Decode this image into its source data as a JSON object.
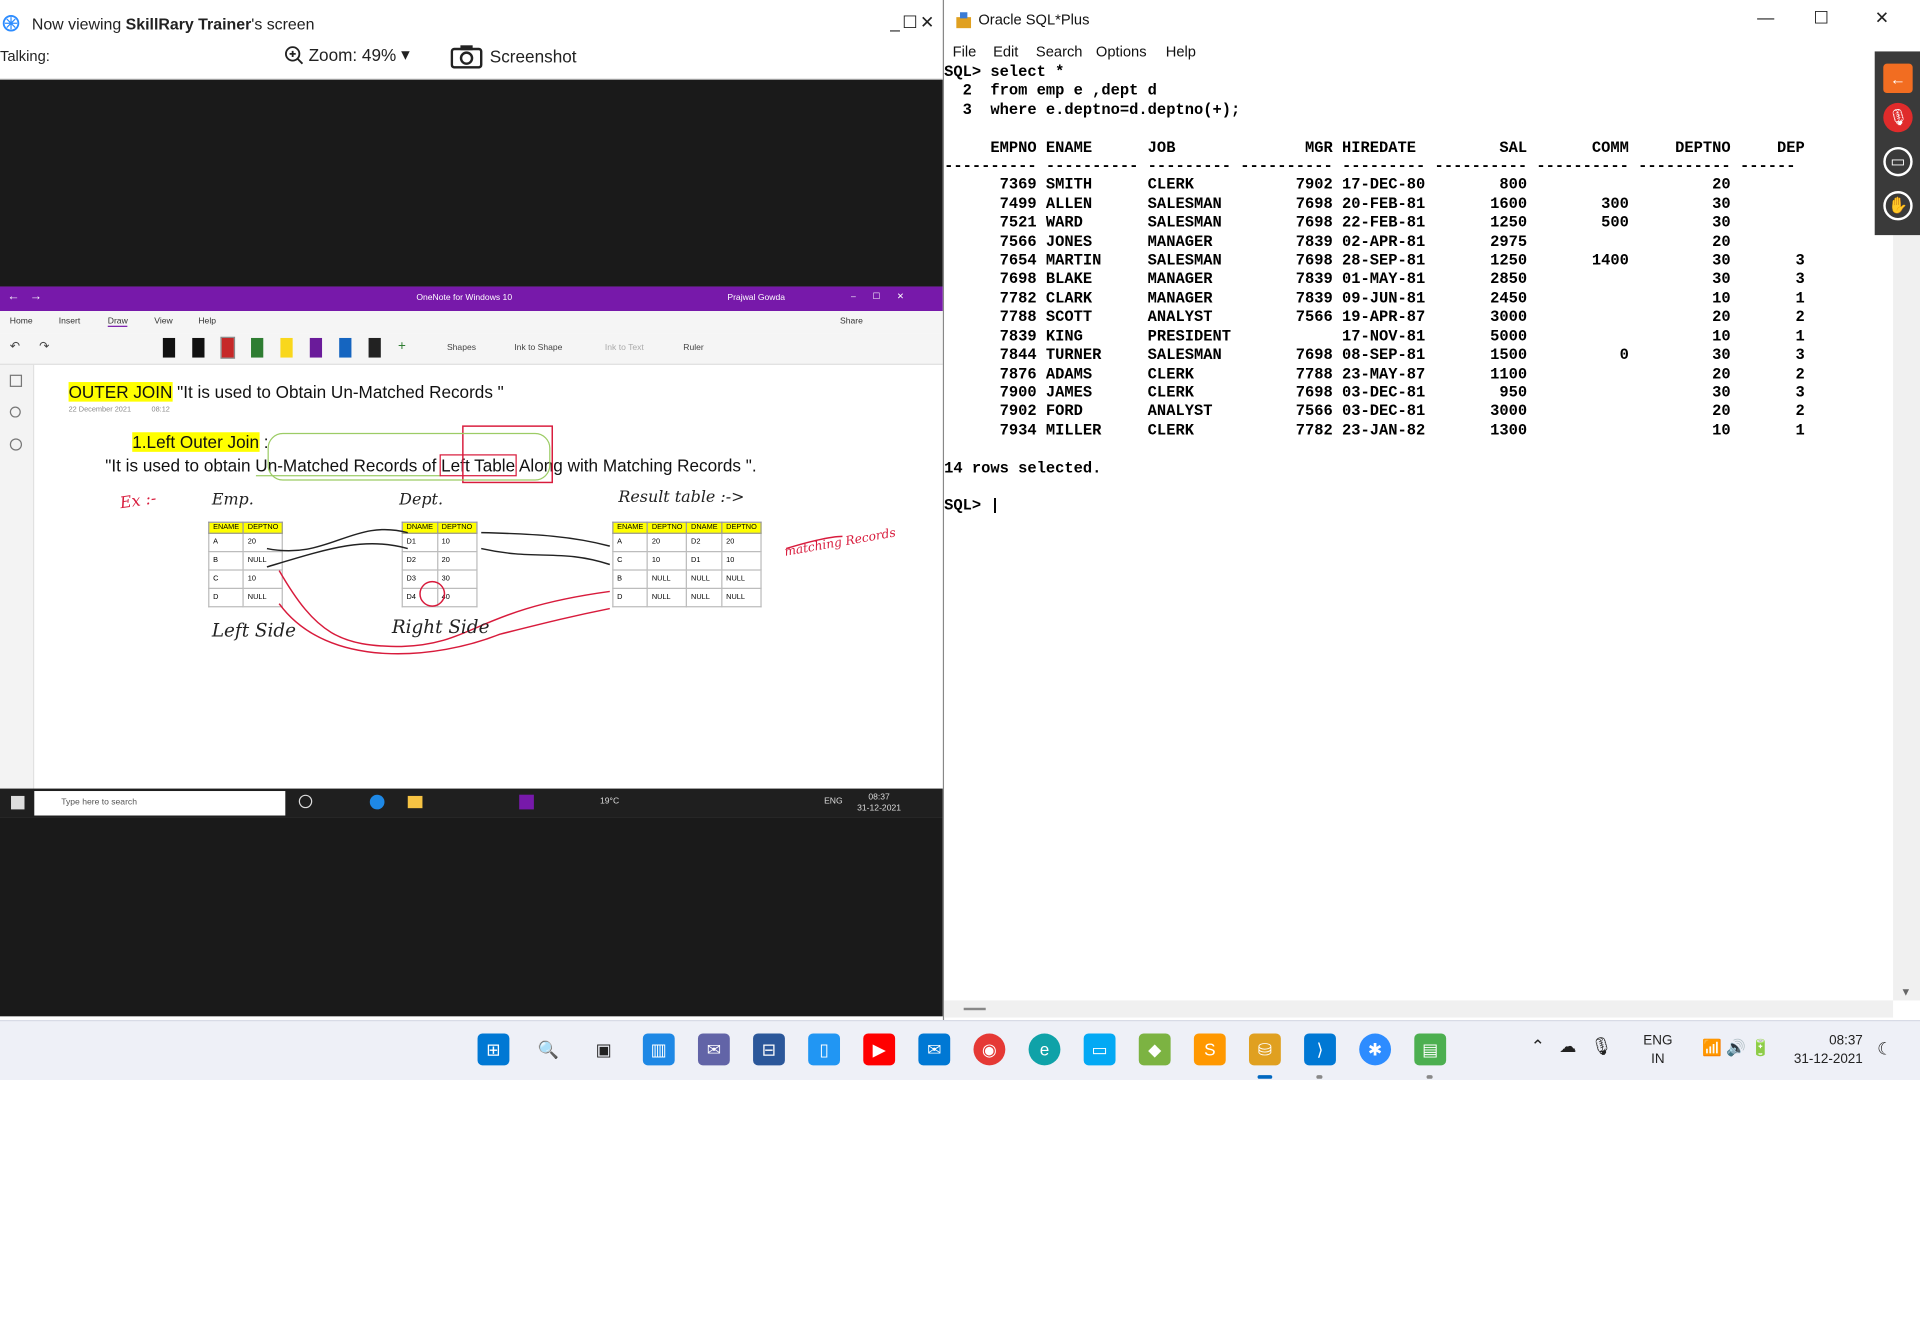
{
  "viewer": {
    "now_viewing": "Now viewing ",
    "presenter": "SkillRary Trainer",
    "screen_suffix": "'s screen",
    "talking": "Talking:",
    "zoom_label": "Zoom: 49%",
    "screenshot_label": "Screenshot",
    "window_controls": [
      "_",
      "☐",
      "✕"
    ]
  },
  "remote": {
    "onenote": {
      "title": "OneNote for Windows 10",
      "user": "Prajwal Gowda",
      "menus": [
        "Home",
        "Insert",
        "Draw",
        "View",
        "Help"
      ],
      "active_menu": "Draw",
      "toolbar": [
        "Shapes",
        "Ink to Shape",
        "Ink to Text",
        "Ruler"
      ],
      "share": "Share"
    },
    "page": {
      "heading": "OUTER JOIN",
      "heading_desc": " \"It is used to Obtain Un-Matched Records \"",
      "date": "22 December 2021",
      "time": "08:12",
      "subheading": "1.Left Outer Join",
      "subheading_colon": " :",
      "desc_pre": "\"It is used to obtain ",
      "desc_boxed1": "Un-Matched Records of ",
      "desc_boxed2": "Left Table",
      "desc_post": " Along with Matching Records \".",
      "ex_label": "Ex :-",
      "emp_label": "Emp.",
      "dept_label": "Dept.",
      "result_label": "Result table :->",
      "left_side": "Left Side",
      "right_side": "Right Side",
      "matching": "matching Records",
      "emp_table": {
        "headers": [
          "ENAME",
          "DEPTNO"
        ],
        "rows": [
          [
            "A",
            "20"
          ],
          [
            "B",
            "NULL"
          ],
          [
            "C",
            "10"
          ],
          [
            "D",
            "NULL"
          ]
        ]
      },
      "dept_table": {
        "headers": [
          "DNAME",
          "DEPTNO"
        ],
        "rows": [
          [
            "D1",
            "10"
          ],
          [
            "D2",
            "20"
          ],
          [
            "D3",
            "30"
          ],
          [
            "D4",
            "40"
          ]
        ]
      },
      "result_table": {
        "headers": [
          "ENAME",
          "DEPTNO",
          "DNAME",
          "DEPTNO"
        ],
        "rows": [
          [
            "A",
            "20",
            "D2",
            "20"
          ],
          [
            "C",
            "10",
            "D1",
            "10"
          ],
          [
            "B",
            "NULL",
            "NULL",
            "NULL"
          ],
          [
            "D",
            "NULL",
            "NULL",
            "NULL"
          ]
        ]
      }
    },
    "win10_taskbar": {
      "search_placeholder": "Type here to search",
      "weather": "19°C",
      "lang": "ENG",
      "time": "08:37",
      "date": "31-12-2021"
    }
  },
  "sqlplus": {
    "title": "Oracle SQL*Plus",
    "window_controls": [
      "—",
      "☐",
      "✕"
    ],
    "menus": [
      "File",
      "Edit",
      "Search",
      "Options",
      "Help"
    ],
    "console_lines": [
      "SQL> select *",
      "  2  from emp e ,dept d",
      "  3  where e.deptno=d.deptno(+);",
      "",
      "     EMPNO ENAME      JOB              MGR HIREDATE         SAL       COMM     DEPTNO     DEP",
      "---------- ---------- --------- ---------- --------- ---------- ---------- ---------- ------",
      "      7369 SMITH      CLERK           7902 17-DEC-80        800                    20",
      "      7499 ALLEN      SALESMAN        7698 20-FEB-81       1600        300         30",
      "      7521 WARD       SALESMAN        7698 22-FEB-81       1250        500         30",
      "      7566 JONES      MANAGER         7839 02-APR-81       2975                    20",
      "      7654 MARTIN     SALESMAN        7698 28-SEP-81       1250       1400         30       3",
      "      7698 BLAKE      MANAGER         7839 01-MAY-81       2850                    30       3",
      "      7782 CLARK      MANAGER         7839 09-JUN-81       2450                    10       1",
      "      7788 SCOTT      ANALYST         7566 19-APR-87       3000                    20       2",
      "      7839 KING       PRESIDENT            17-NOV-81       5000                    10       1",
      "      7844 TURNER     SALESMAN        7698 08-SEP-81       1500          0         30       3",
      "      7876 ADAMS      CLERK           7788 23-MAY-87       1100                    20       2",
      "      7900 JAMES      CLERK           7698 03-DEC-81        950                    30       3",
      "      7902 FORD       ANALYST         7566 03-DEC-81       3000                    20       2",
      "      7934 MILLER     CLERK           7782 23-JAN-82       1300                    10       1",
      "",
      "14 rows selected.",
      "",
      "SQL> |"
    ]
  },
  "taskbar": {
    "apps": [
      "start-icon",
      "search-icon",
      "task-view-icon",
      "widgets-icon",
      "chat-icon",
      "store-icon",
      "phone-icon",
      "youtube-icon",
      "mail-icon",
      "chrome-icon",
      "edge-icon",
      "remote-desktop-icon",
      "gem-icon",
      "sublime-icon",
      "sqlplus-icon",
      "vscode-icon",
      "zoom-icon",
      "notepad-icon"
    ],
    "lang_line1": "ENG",
    "lang_line2": "IN",
    "time": "08:37",
    "date": "31-12-2021"
  },
  "colors": {
    "onenote_purple": "#7719aa",
    "highlight_yellow": "#ffff00",
    "ink_red": "#d81b3c",
    "taskbar_bg": "#eef0f7"
  }
}
